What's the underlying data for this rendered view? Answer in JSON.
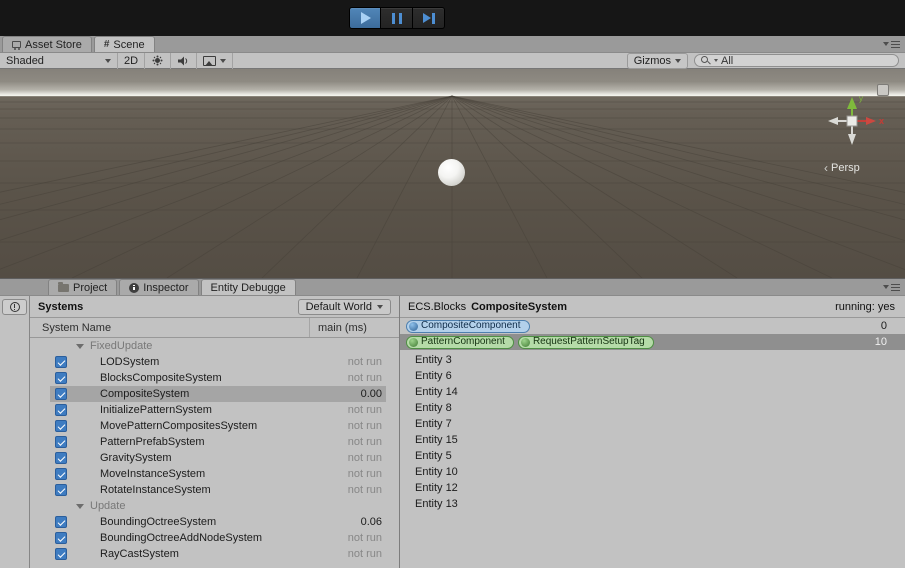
{
  "top_tabs": {
    "asset_store": "Asset Store",
    "scene": "Scene"
  },
  "scene_toolbar": {
    "shading_mode": "Shaded",
    "toggle_2d": "2D",
    "gizmos": "Gizmos",
    "search_filter": "All"
  },
  "scene": {
    "projection": "Persp",
    "axis_x_label": "x",
    "axis_y_label": "y"
  },
  "bottom_tabs": {
    "project": "Project",
    "inspector": "Inspector",
    "entity_debugger": "Entity Debugge"
  },
  "systems_panel": {
    "title": "Systems",
    "world_selector": "Default World",
    "columns": {
      "name": "System Name",
      "time": "main (ms)"
    },
    "rows": [
      {
        "group": "FixedUpdate"
      },
      {
        "name": "LODSystem",
        "time": "not run"
      },
      {
        "name": "BlocksCompositeSystem",
        "time": "not run"
      },
      {
        "name": "CompositeSystem",
        "time": "0.00",
        "selected": true
      },
      {
        "name": "InitializePatternSystem",
        "time": "not run"
      },
      {
        "name": "MovePatternCompositesSystem",
        "time": "not run"
      },
      {
        "name": "PatternPrefabSystem",
        "time": "not run"
      },
      {
        "name": "GravitySystem",
        "time": "not run"
      },
      {
        "name": "MoveInstanceSystem",
        "time": "not run"
      },
      {
        "name": "RotateInstanceSystem",
        "time": "not run"
      },
      {
        "group": "Update"
      },
      {
        "name": "BoundingOctreeSystem",
        "time": "0.06"
      },
      {
        "name": "BoundingOctreeAddNodeSystem",
        "time": "not run"
      },
      {
        "name": "RayCastSystem",
        "time": "not run"
      }
    ]
  },
  "detail_panel": {
    "heading_prefix": "ECS.Blocks",
    "heading": "CompositeSystem",
    "status": "running: yes",
    "component_rows": [
      {
        "pills": [
          "CompositeComponent"
        ],
        "count": "0"
      },
      {
        "pills": [
          "PatternComponent",
          "RequestPatternSetupTag"
        ],
        "count": "10",
        "selected": true
      }
    ],
    "entities": [
      "Entity 3",
      "Entity 6",
      "Entity 14",
      "Entity 8",
      "Entity 7",
      "Entity 15",
      "Entity 5",
      "Entity 10",
      "Entity 12",
      "Entity 13"
    ]
  },
  "icons": {
    "transport": [
      "play",
      "pause",
      "step-forward"
    ],
    "scene_toolbar": [
      "sun-lighting",
      "audio-speaker",
      "image-effects"
    ],
    "search": "magnifier",
    "tabs": {
      "asset_store": "cart",
      "scene": "grid",
      "project": "folder",
      "inspector": "info-circle"
    },
    "gutter": "console-exclamation",
    "scene": "orientation-gizmo"
  },
  "colors": {
    "play_active": "#4a7eb3",
    "checkbox_blue": "#3e7cc1",
    "pill_blue": "#b3d0ea",
    "pill_green": "#b5dba8",
    "selected_system_row": "#a5a5a5",
    "selected_component_row": "#8f8f8f",
    "toolbar_dark": "#161616",
    "panel_bg": "#c2c2c2"
  }
}
